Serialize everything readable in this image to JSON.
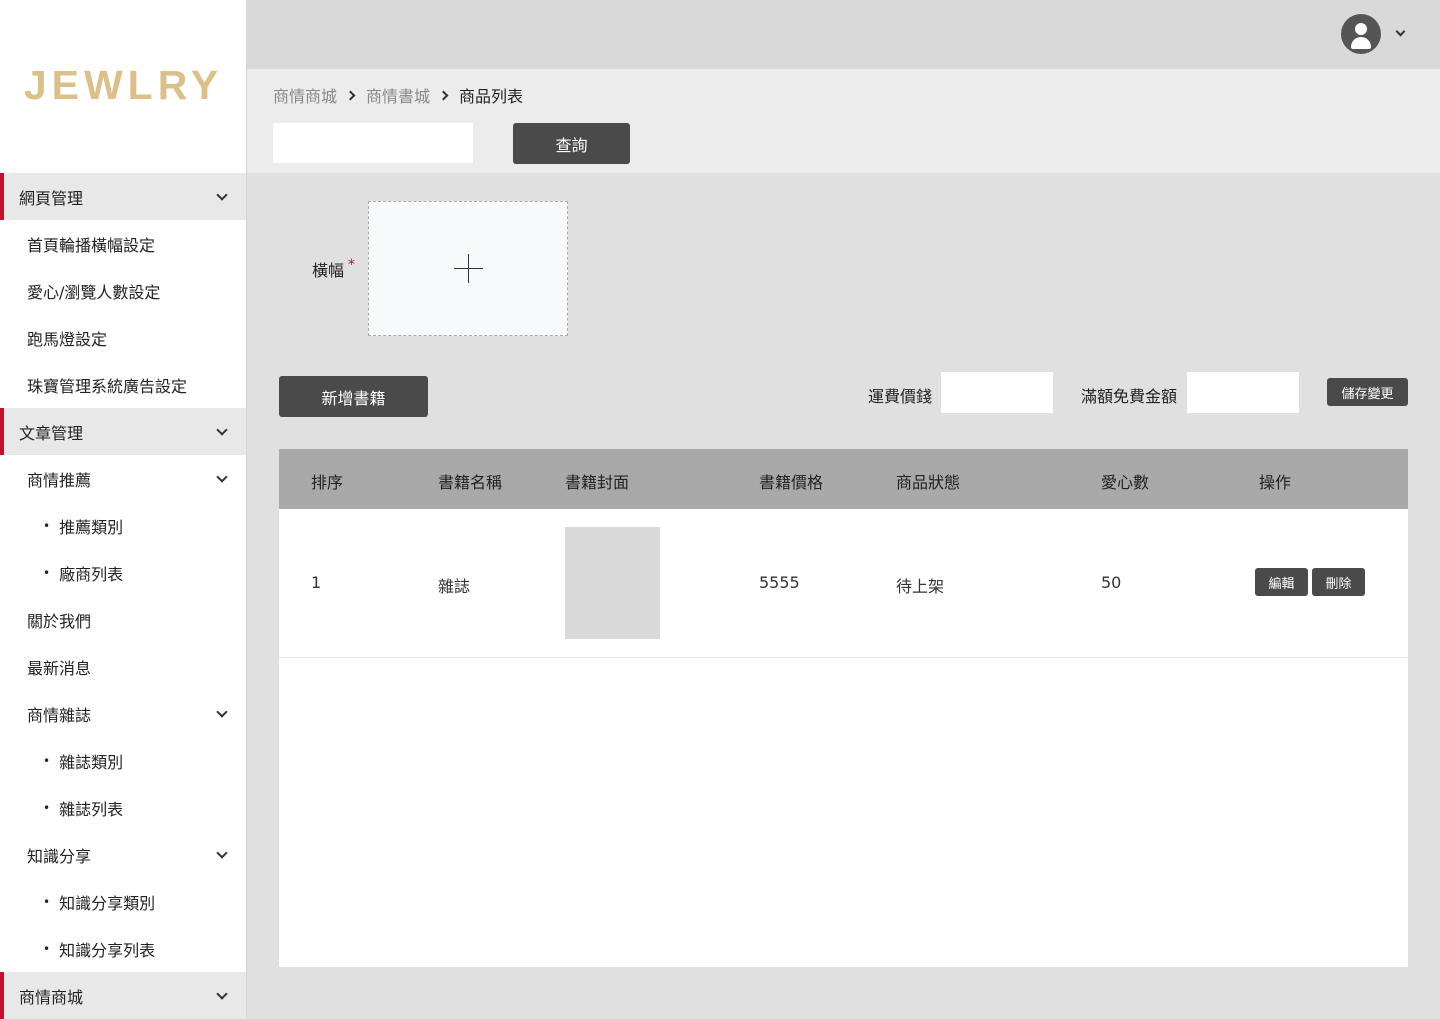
{
  "brand": {
    "logo": "JEWLRY"
  },
  "sidebar": {
    "items": [
      {
        "label": "網頁管理",
        "level": "group",
        "chevron": true
      },
      {
        "label": "首頁輪播橫幅設定",
        "level": "sub",
        "chevron": false
      },
      {
        "label": "愛心/瀏覽人數設定",
        "level": "sub",
        "chevron": false
      },
      {
        "label": "跑馬燈設定",
        "level": "sub",
        "chevron": false
      },
      {
        "label": "珠寶管理系統廣告設定",
        "level": "sub",
        "chevron": false
      },
      {
        "label": "文章管理",
        "level": "group",
        "chevron": true
      },
      {
        "label": "商情推薦",
        "level": "sub",
        "chevron": true
      },
      {
        "label": "推薦類別",
        "level": "subsub",
        "chevron": false
      },
      {
        "label": "廠商列表",
        "level": "subsub",
        "chevron": false
      },
      {
        "label": "關於我們",
        "level": "sub",
        "chevron": false
      },
      {
        "label": "最新消息",
        "level": "sub",
        "chevron": false
      },
      {
        "label": "商情雜誌",
        "level": "sub",
        "chevron": true
      },
      {
        "label": "雜誌類別",
        "level": "subsub",
        "chevron": false
      },
      {
        "label": "雜誌列表",
        "level": "subsub",
        "chevron": false
      },
      {
        "label": "知識分享",
        "level": "sub",
        "chevron": true
      },
      {
        "label": "知識分享類別",
        "level": "subsub",
        "chevron": false
      },
      {
        "label": "知識分享列表",
        "level": "subsub",
        "chevron": false
      },
      {
        "label": "商情商城",
        "level": "group",
        "chevron": true
      }
    ],
    "bullet": "•"
  },
  "header": {
    "avatar_icon": "user-avatar-icon"
  },
  "breadcrumb": [
    "商情商城",
    "商情書城",
    "商品列表"
  ],
  "search": {
    "value": "",
    "placeholder": "",
    "button_label": "查詢"
  },
  "banner": {
    "label": "橫幅",
    "required_mark": "*"
  },
  "toolbar": {
    "add_label": "新增書籍",
    "shipping_label": "運費價錢",
    "shipping_value": "",
    "free_threshold_label": "滿額免費金額",
    "free_threshold_value": "",
    "save_label": "儲存變更"
  },
  "table": {
    "headers": [
      "排序",
      "書籍名稱",
      "書籍封面",
      "書籍價格",
      "商品狀態",
      "愛心數",
      "操作"
    ],
    "rows": [
      {
        "order": "1",
        "name": "雜誌",
        "price": "5555",
        "status": "待上架",
        "likes": "50",
        "edit": "編輯",
        "delete": "刪除"
      }
    ]
  },
  "colors": {
    "accent_red": "#c8102e",
    "logo_gold": "#dcc08a",
    "button_dark": "#4a4a4a"
  }
}
